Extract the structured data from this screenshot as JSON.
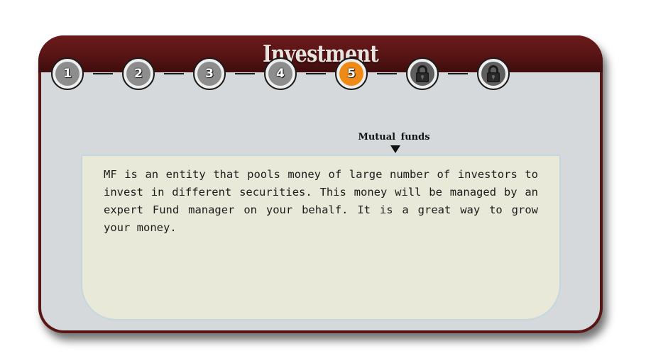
{
  "panel": {
    "title": "Investment"
  },
  "steps": [
    {
      "label": "1",
      "state": "completed"
    },
    {
      "label": "2",
      "state": "completed"
    },
    {
      "label": "3",
      "state": "completed"
    },
    {
      "label": "4",
      "state": "completed"
    },
    {
      "label": "5",
      "state": "active"
    },
    {
      "label": "",
      "state": "locked",
      "icon": "lock-icon"
    },
    {
      "label": "",
      "state": "locked",
      "icon": "lock-icon"
    }
  ],
  "current_step": {
    "caption": "Mutual funds",
    "description": "MF is an entity that pools money of large number of investors to invest in different securities. This money will be managed by an expert Fund manager on your behalf. It is a great way to grow your money."
  },
  "colors": {
    "frame": "#5a1616",
    "body": "#d6d9dc",
    "active_step": "#f08a17",
    "completed_step": "#8d8d8d",
    "locked_step": "#5e5e5e",
    "content_background": "#e8e9d9"
  }
}
